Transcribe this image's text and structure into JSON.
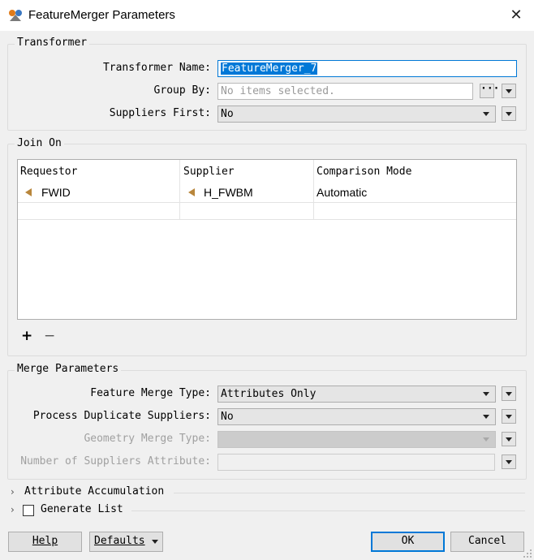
{
  "window": {
    "title": "FeatureMerger Parameters"
  },
  "transformer_group": {
    "legend": "Transformer",
    "name_label": "Transformer Name:",
    "name_value": "FeatureMerger_7",
    "group_by_label": "Group By:",
    "group_by_placeholder": "No items selected.",
    "group_by_button": "···",
    "suppliers_first_label": "Suppliers First:",
    "suppliers_first_value": "No"
  },
  "join_on": {
    "legend": "Join On",
    "columns": [
      "Requestor",
      "Supplier",
      "Comparison Mode"
    ],
    "rows": [
      {
        "requestor": "FWID",
        "supplier": "H_FWBM",
        "mode": "Automatic"
      }
    ],
    "add_label": "+",
    "remove_label": "−"
  },
  "merge_params": {
    "legend": "Merge Parameters",
    "feature_merge_type_label": "Feature Merge Type:",
    "feature_merge_type_value": "Attributes Only",
    "process_duplicate_label": "Process Duplicate Suppliers:",
    "process_duplicate_value": "No",
    "geometry_merge_type_label": "Geometry Merge Type:",
    "geometry_merge_type_value": "",
    "num_suppliers_attr_label": "Number of Suppliers Attribute:",
    "num_suppliers_attr_value": ""
  },
  "sections": {
    "attribute_accumulation": "Attribute Accumulation",
    "generate_list": "Generate List"
  },
  "footer": {
    "help": "Help",
    "defaults": "Defaults",
    "ok": "OK",
    "cancel": "Cancel"
  },
  "colors": {
    "selection": "#0078d7",
    "attr_icon": "#b8863b",
    "ok_border": "#0078d7"
  }
}
